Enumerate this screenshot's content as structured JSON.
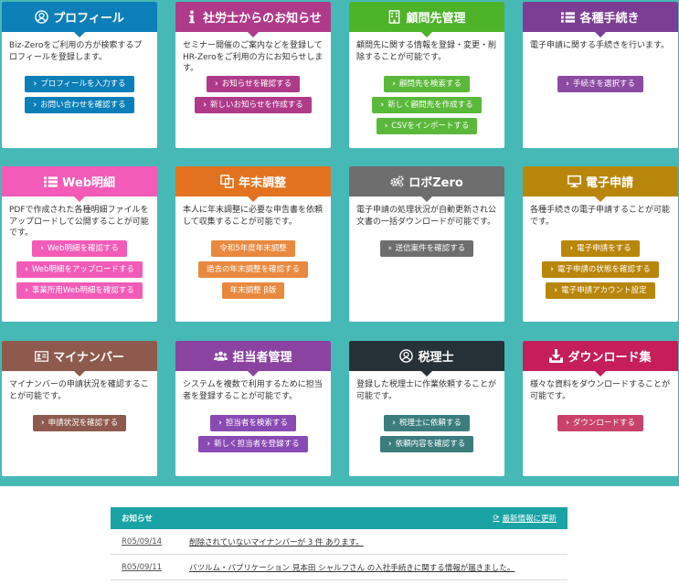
{
  "cards": [
    {
      "id": "profile",
      "title": "プロフィール",
      "icon": "user-icon",
      "color": "#0d7fb8",
      "desc": "Biz-Zeroをご利用の方が検索するプロフィールを登録します。",
      "buttons": [
        "プロフィールを入力する",
        "お問い合わせを確認する"
      ]
    },
    {
      "id": "sharoushi",
      "title": "社労士からのお知らせ",
      "icon": "info-icon",
      "color": "#b03a8a",
      "desc": "セミナー開催のご案内などを登録してHR-Zeroをご利用の方にお知らせします。",
      "buttons": [
        "お知らせを確認する",
        "新しいお知らせを作成する"
      ]
    },
    {
      "id": "client",
      "title": "顧問先管理",
      "icon": "building-icon",
      "color": "#4db328",
      "desc": "顧問先に関する情報を登録・変更・削除することが可能です。",
      "buttons": [
        "顧問先を検索する",
        "新しく顧問先を作成する",
        "CSVをインポートする"
      ]
    },
    {
      "id": "procedures",
      "title": "各種手続き",
      "icon": "list-icon",
      "color": "#7d3d95",
      "desc": "電子申請に関する手続きを行います。",
      "buttons": [
        "手続きを選択する"
      ]
    },
    {
      "id": "web-payslip",
      "title": "Web明細",
      "icon": "list-icon",
      "color": "#f25bb7",
      "desc": "PDFで作成された各種明細ファイルをアップロードして公開することが可能です。",
      "buttons": [
        "Web明細を確認する",
        "Web明細をアップロードする",
        "事業所用Web明細を確認する"
      ]
    },
    {
      "id": "year-end",
      "title": "年末調整",
      "icon": "copy-icon",
      "color": "#e2721f",
      "desc": "本人に年末調整に必要な申告書を依頼して収集することが可能です。",
      "buttons": [
        "令和5年度年末調整",
        "過去の年末調整を確認する",
        "年末調整 β版"
      ]
    },
    {
      "id": "robozero",
      "title": "ロボZero",
      "icon": "gears-icon",
      "color": "#6e6e6e",
      "desc": "電子申請の処理状況が自動更新され公文書の一括ダウンロードが可能です。",
      "buttons": [
        "送信案件を確認する"
      ]
    },
    {
      "id": "e-filing",
      "title": "電子申請",
      "icon": "monitor-icon",
      "color": "#b8860b",
      "desc": "各種手続きの電子申請することが可能です。",
      "buttons": [
        "電子申請をする",
        "電子申請の状態を確認する",
        "電子申請アカウント設定"
      ]
    },
    {
      "id": "mynumber",
      "title": "マイナンバー",
      "icon": "id-card-icon",
      "color": "#8d5a4d",
      "desc": "マイナンバーの申請状況を確認することが可能です。",
      "buttons": [
        "申請状況を確認する"
      ]
    },
    {
      "id": "staff",
      "title": "担当者管理",
      "icon": "users-icon",
      "color": "#8a43a0",
      "desc": "システムを複数で利用するために担当者を登録することが可能です。",
      "buttons": [
        "担当者を検索する",
        "新しく担当者を登録する"
      ]
    },
    {
      "id": "tax-accountant",
      "title": "税理士",
      "icon": "user-icon",
      "color": "#263238",
      "desc": "登録した税理士に作業依頼することが可能です。",
      "buttons": [
        "税理士に依頼する",
        "依頼内容を確認する"
      ]
    },
    {
      "id": "download",
      "title": "ダウンロード集",
      "icon": "download-icon",
      "color": "#c51e5a",
      "desc": "様々な資料をダウンロードすることが可能です。",
      "buttons": [
        "ダウンロードする"
      ]
    }
  ],
  "button_colors": {
    "profile": "#0d7fb8",
    "sharoushi": "#b03a8a",
    "client": "#5ab83a",
    "procedures": "#8c4aa3",
    "web-payslip": "#f25bb7",
    "year-end": "#e8893f",
    "robozero": "#6e6e6e",
    "e-filing": "#b8860b",
    "mynumber": "#8d5a4d",
    "staff": "#8a4ab3",
    "tax-accountant": "#3b7d7d",
    "download": "#c9426e"
  },
  "plain_buttons": [
    "令和5年度年末調整",
    "過去の年末調整を確認する",
    "年末調整 β版"
  ],
  "news": {
    "title": "お知らせ",
    "refresh_label": "最新情報に更新",
    "items": [
      {
        "date": "R05/09/14",
        "text": "削除されていないマイナンバーが 3 件 あります。"
      },
      {
        "date": "R05/09/11",
        "text": "バツルム・パプリケーション 見本田 シャルフさん の入社手続きに関する情報が届きました。"
      }
    ]
  }
}
